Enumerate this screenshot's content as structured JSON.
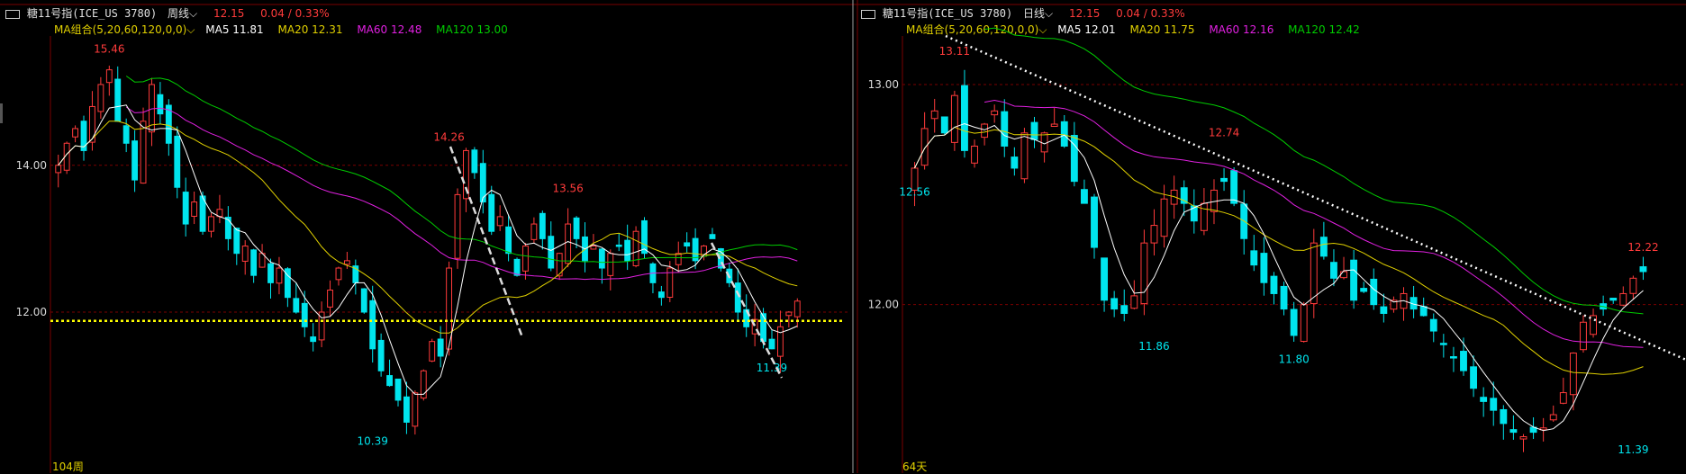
{
  "colors": {
    "up": "#ff3b3b",
    "down": "#00e5ee",
    "ma5": "#ffffff",
    "ma20": "#e0d000",
    "ma60": "#e020e0",
    "ma120": "#00cc00",
    "grid": "#7a0000",
    "frame": "#7a0000",
    "axis_label": "#d8d8d8",
    "bg": "#000000"
  },
  "panels": [
    {
      "id": "weekly",
      "header": {
        "name": "糖11号指(ICE_US 3780)",
        "period": "周线",
        "price": "12.15",
        "change": "0.04 / 0.33%"
      },
      "ma_row": {
        "label": "MA组合(5,20,60,120,0,0)",
        "ma5": "MA5 11.81",
        "ma20": "MA20 12.31",
        "ma60": "MA60 12.48",
        "ma120": "MA120 13.00"
      },
      "footer": "104周",
      "chart_data": {
        "type": "candlestick",
        "ylim": [
          10.15,
          15.7
        ],
        "y_ticks": [
          12.0,
          14.0
        ],
        "y_tick_labels": [
          "12.00",
          "14.00"
        ],
        "annotations": [
          {
            "text": "15.46",
            "value": 15.46,
            "bar": 6,
            "kind": "high"
          },
          {
            "text": "14.26",
            "value": 14.26,
            "bar": 46,
            "kind": "high"
          },
          {
            "text": "13.56",
            "value": 13.56,
            "bar": 60,
            "kind": "high"
          },
          {
            "text": "10.39",
            "value": 10.39,
            "bar": 37,
            "kind": "low"
          },
          {
            "text": "11.39",
            "value": 11.39,
            "bar": 84,
            "kind": "low"
          }
        ],
        "support_level": 11.88,
        "close_series": [
          14.0,
          14.3,
          14.5,
          14.2,
          14.8,
          15.1,
          15.3,
          14.6,
          14.3,
          13.8,
          14.6,
          15.1,
          14.7,
          14.3,
          13.7,
          13.2,
          13.5,
          13.1,
          13.3,
          13.4,
          13.0,
          12.8,
          12.9,
          12.5,
          12.8,
          12.4,
          12.6,
          12.2,
          12.0,
          11.8,
          11.6,
          12.0,
          12.3,
          12.6,
          12.7,
          12.4,
          12.0,
          11.5,
          11.2,
          11.0,
          10.8,
          10.5,
          10.9,
          11.2,
          11.6,
          11.4,
          12.6,
          13.6,
          14.2,
          13.9,
          13.5,
          13.1,
          13.3,
          12.8,
          12.5,
          12.9,
          13.2,
          13.0,
          12.6,
          12.8,
          13.2,
          13.0,
          12.7,
          12.9,
          12.6,
          12.8,
          12.9,
          12.7,
          13.1,
          12.8,
          12.4,
          12.2,
          12.6,
          12.8,
          12.9,
          12.7,
          12.9,
          13.0,
          12.6,
          12.4,
          12.0,
          11.8,
          11.9,
          11.6,
          11.5,
          11.8,
          12.0,
          12.15
        ]
      }
    },
    {
      "id": "daily",
      "header": {
        "name": "糖11号指(ICE_US 3780)",
        "period": "日线",
        "price": "12.15",
        "change": "0.04 / 0.33%"
      },
      "ma_row": {
        "label": "MA组合(5,20,60,120,0,0)",
        "ma5": "MA5 12.01",
        "ma20": "MA20 11.75",
        "ma60": "MA60 12.16",
        "ma120": "MA120 12.42"
      },
      "footer": "64天",
      "chart_data": {
        "type": "candlestick",
        "ylim": [
          11.3,
          13.2
        ],
        "y_ticks": [
          12.0,
          13.0
        ],
        "y_tick_labels": [
          "12.00",
          "13.00"
        ],
        "annotations": [
          {
            "text": "13.11",
            "value": 13.11,
            "bar": 4,
            "kind": "high"
          },
          {
            "text": "12.56",
            "value": 12.56,
            "bar": 0,
            "kind": "low"
          },
          {
            "text": "12.74",
            "value": 12.74,
            "bar": 31,
            "kind": "high"
          },
          {
            "text": "11.86",
            "value": 11.86,
            "bar": 24,
            "kind": "low"
          },
          {
            "text": "11.80",
            "value": 11.8,
            "bar": 38,
            "kind": "low"
          },
          {
            "text": "12.22",
            "value": 12.22,
            "bar": 76,
            "kind": "high"
          },
          {
            "text": "11.39",
            "value": 11.39,
            "bar": 72,
            "kind": "low"
          }
        ],
        "close_series": [
          12.62,
          12.8,
          12.88,
          12.78,
          12.95,
          12.7,
          12.72,
          12.82,
          12.88,
          12.72,
          12.62,
          12.78,
          12.75,
          12.78,
          12.82,
          12.72,
          12.56,
          12.46,
          12.26,
          12.02,
          11.98,
          11.96,
          12.04,
          12.28,
          12.36,
          12.48,
          12.52,
          12.46,
          12.38,
          12.46,
          12.52,
          12.56,
          12.46,
          12.3,
          12.18,
          12.1,
          12.05,
          11.98,
          11.86,
          12.0,
          12.28,
          12.22,
          12.12,
          12.15,
          12.02,
          12.06,
          12.0,
          11.96,
          12.02,
          12.05,
          11.98,
          11.95,
          11.88,
          11.82,
          11.76,
          11.7,
          11.62,
          11.56,
          11.52,
          11.46,
          11.42,
          11.4,
          11.42,
          11.44,
          11.5,
          11.6,
          11.78,
          11.92,
          11.95,
          11.98,
          12.02,
          12.05,
          12.12,
          12.15
        ]
      }
    }
  ]
}
